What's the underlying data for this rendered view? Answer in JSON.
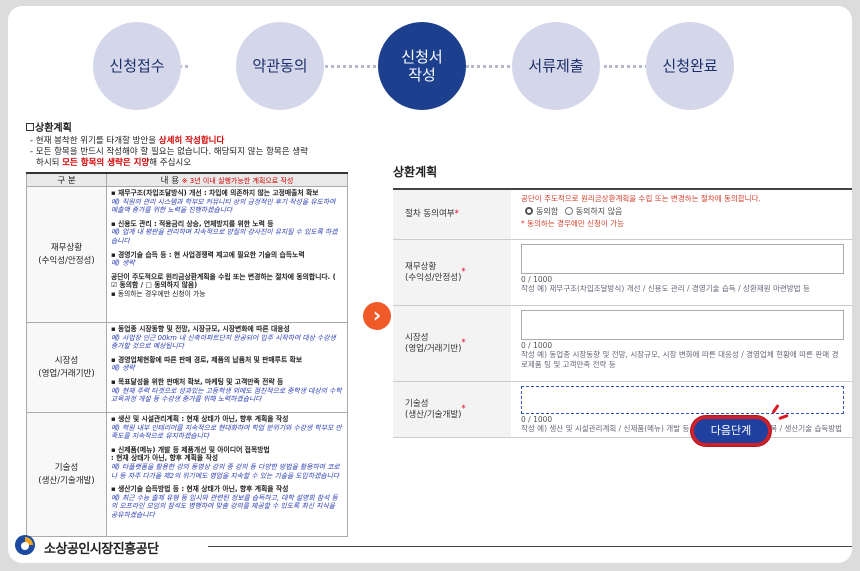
{
  "steps": [
    {
      "label": "신청접수",
      "active": false
    },
    {
      "label": "약관동의",
      "active": false
    },
    {
      "label": "신청서\n작성",
      "active": true
    },
    {
      "label": "서류제출",
      "active": false
    },
    {
      "label": "신청완료",
      "active": false
    }
  ],
  "left": {
    "title": "상환계획",
    "note1_pre": "- 현재 봉착한 위기를 타개할 방안을 ",
    "note1_red": "상세히 작성합니다",
    "note2_a": "- 모든 항목을 반드시 작성해야 할 필요는 없습니다. 해당되지 않는 항목은 생략",
    "note2_b_pre": "하시되 ",
    "note2_b_red": "모든 항목의 생략은 지양",
    "note2_b_post": "해 주십시오",
    "table_header_cat": "구 분",
    "table_header_content": "내 용",
    "table_header_small": "※ 3년 이내 실행가능한 계획으로 작성",
    "rows": [
      {
        "category": "재무상황\n(수익성/안정성)",
        "items": [
          {
            "head": "▪ 재무구조(차입조달방식) 개선 : 차입에 의존하지 않는 고정매출처 확보",
            "ex": "예) 직원의 관리 시스템과 학부모 커뮤니티 상의 긍정적인 후기 작성을 유도하여 매출액 증가를 위한 노력을 진행하겠습니다"
          },
          {
            "head": "▪ 신용도 관리 : 적용금리 상승, 연체방지를 위한 노력 등",
            "ex": "예) 업계 내 평판을 관리하며 지속적으로 양질의 강사진이 유지될 수 있도록 하겠습니다"
          },
          {
            "head": "▪ 경영기술 습득 등 : 현 사업경쟁력 제고에 필요한 기술의 습득노력",
            "ex": "예) 생략"
          },
          {
            "head": "공단이 주도적으로 원리금상환계획을 수립 또는 변경하는 절차에 동의합니다. ( ☑ 동의함 / □ 동의하지 않음)",
            "ex": "▪ 동의하는 경우에만 신청이 가능"
          }
        ]
      },
      {
        "category": "시장성\n(영업/거래기반)",
        "items": [
          {
            "head": "▪ 동업종 시장동향 및 전망, 시장규모, 시장변화에 따른 대응성",
            "ex": "예) 사업장 인근 00km 내 신축아파트단지 완공되어 입주 시작하여 대상 수강생 증가할 것으로 예상됩니다"
          },
          {
            "head": "▪ 경영업체현황에 따른 판매 경로, 제품의 납품처 및 판매루트 확보",
            "ex": "예) 생략"
          },
          {
            "head": "▪ 목표달성을 위한 판매처 확보, 마케팅 및 고객만족 전략 등",
            "ex": "예) 현재 주력 타겟으로 성과있는 고등학생 외에도 점진적으로 중학생 대상의 수학교육과정 개설 등 수강생 증가를 위해 노력하겠습니다"
          }
        ]
      },
      {
        "category": "기술성\n(생산/기술개발)",
        "items": [
          {
            "head": "▪ 생산 및 시설관리계획 : 현재 상태가 아닌, 향후 계획을 작성",
            "ex": "예) 학원 내부 인테리어를 지속적으로 현대화하여 학업 분위기와 수강생 학부모 만족도를 지속적으로 유지하겠습니다"
          },
          {
            "head": "▪ 신제품(메뉴) 개발 등 제품개선 및 아이디어 접목방법\n : 현재 상태가 아닌, 향후 계획을 작성",
            "ex": "예) 타플랫폼을 활용한 강의 동영상 강의 중 강의 등 다양한 방법을 활용하여 코로나 등 자주 다가올 제2의 위기에도 영업을 지속할 수 있는 기술을 도입하겠습니다"
          },
          {
            "head": "▪ 생산기술 습득방법 등 : 현재 상태가 아닌, 향후 계획을 작성",
            "ex": "예) 최근 수능 출제 유형 등 입시와 관련된 정보를 습득하고, 대학 설명회 참석 등의 오프라인 모임의 참석도 병행하여 맞춤 강의를 제공할 수 있도록 최신 지식을 공유하겠습니다"
          }
        ]
      }
    ]
  },
  "right": {
    "title": "상환계획",
    "rows": {
      "consent": {
        "label": "절차 동의여부",
        "text": "공단이 주도적으로 원리금상환계획을 수립 또는 변경하는 절차에 동의합니다.",
        "opt_yes": "동의함",
        "opt_no": "동의하지 않음",
        "footnote": "* 동의하는 경우에만 신청이 가능"
      },
      "finance": {
        "label": "재무상황\n(수익성/안정성)",
        "counter": "0 / 1000",
        "hint": "작성 예) 재무구조(차입조달방식) 개선 / 신용도 관리 / 경영기술 습득 / 상환재원 마련방법 등"
      },
      "market": {
        "label": "시장성\n(영업/거래기반)",
        "counter": "0 / 1000",
        "hint": "작성 예) 동업종 시장동향 및 전망, 시장규모, 시장 변화에 따른 대응성 / 경영업체 현황에 따른 판매 경로제품 팅 및 고객만족 전략 등"
      },
      "tech": {
        "label": "기술성\n(생산/기술개발)",
        "counter": "0 / 1000",
        "hint": "작성 예) 생산 및 시설관리계획 / 신제품(메뉴) 개발 등 제품 개선 및 아이디어 접목 / 생산기술 습득방법"
      }
    },
    "next_button": "다음단계"
  },
  "footer": {
    "org_name": "소상공인시장진흥공단"
  },
  "colors": {
    "step_active": "#1c3f8e",
    "step_inactive": "#d4d7ea",
    "accent_red": "#d20000",
    "next_button": "#2040a0",
    "arrow": "#f05a28"
  }
}
